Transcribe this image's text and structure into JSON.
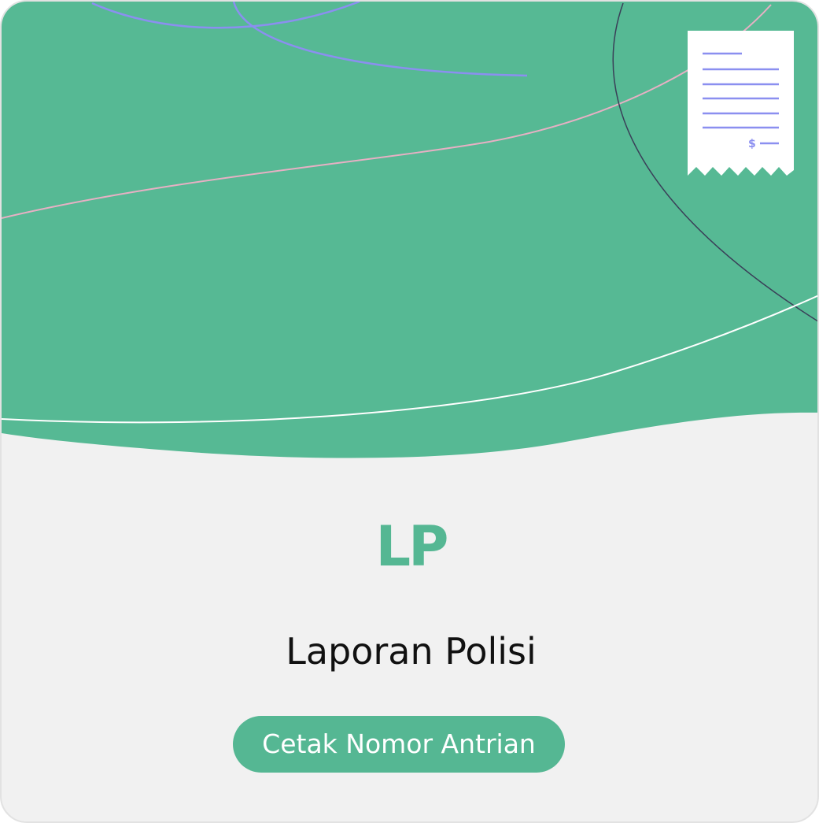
{
  "card": {
    "code": "LP",
    "service_name": "Laporan Polisi",
    "button_label": "Cetak Nomor Antrian",
    "receipt_symbol": "$",
    "icon": "receipt-icon"
  },
  "colors": {
    "brand_green": "#55b793",
    "background": "#f1f1f1",
    "accent_purple": "#8b8ff0",
    "text_dark": "#111111"
  }
}
